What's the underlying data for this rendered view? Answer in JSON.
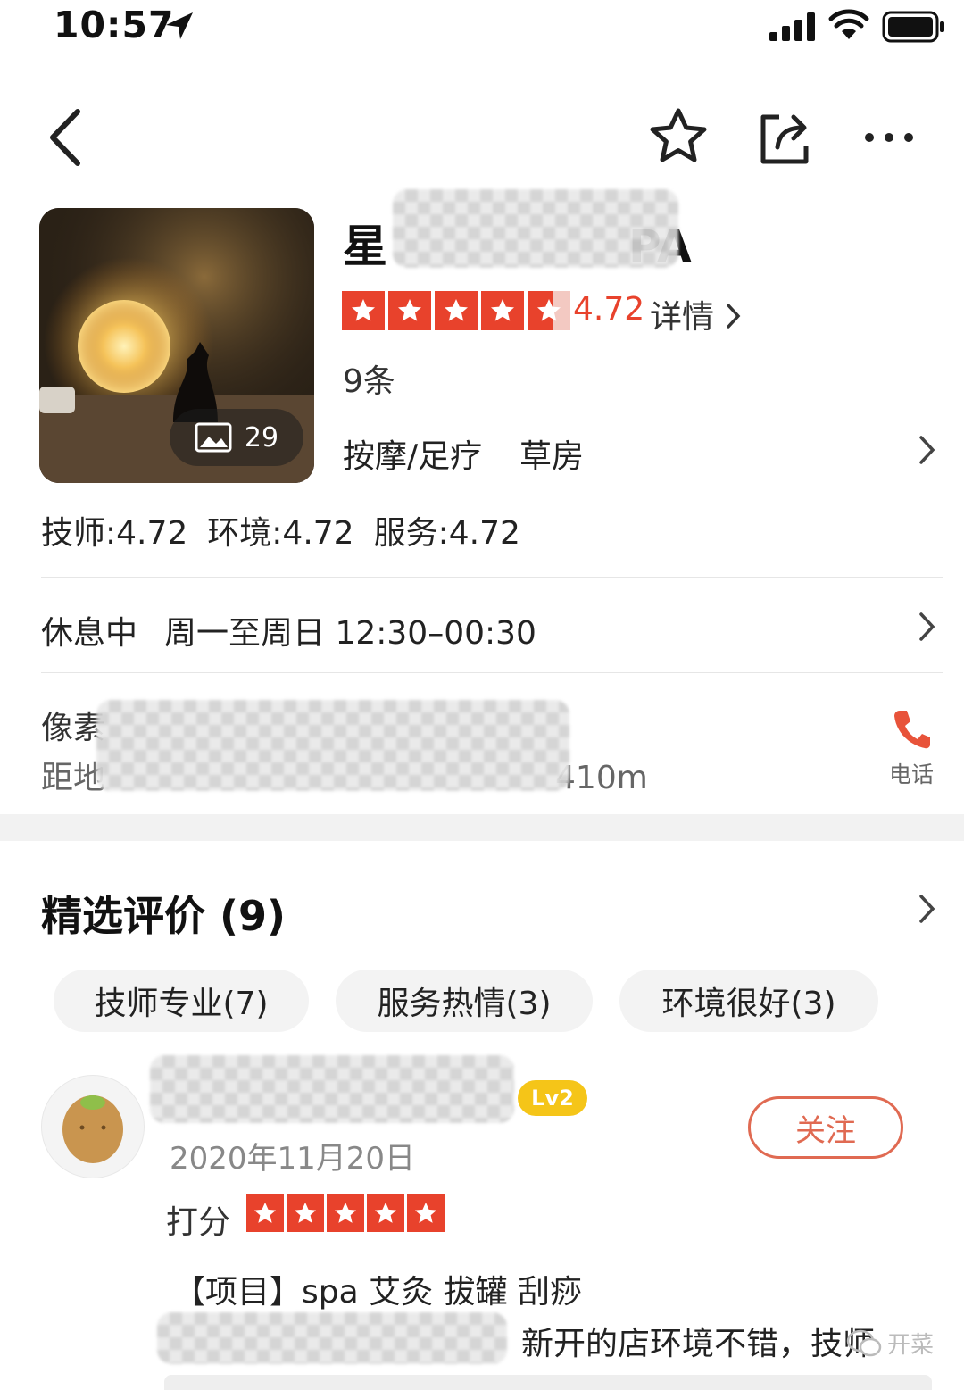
{
  "status_bar": {
    "time": "10:57"
  },
  "shop": {
    "title_start": "星",
    "title_end": "PA",
    "photo_count": "29",
    "score": "4.72",
    "detail_label": "详情",
    "review_count_label": "9条",
    "category": "按摩/足疗",
    "area": "草房",
    "sub_scores": [
      "技师:4.72",
      "环境:4.72",
      "服务:4.72"
    ],
    "star_rating": 4.72
  },
  "hours": {
    "status": "休息中",
    "range": "周一至周日 12:30–00:30"
  },
  "address": {
    "line1_visible": "像素",
    "metro_start": "距地",
    "metro_end": "410m"
  },
  "phone": {
    "label": "电话"
  },
  "reviews": {
    "title": "精选评价",
    "count": "(9)",
    "tags": [
      "技师专业(7)",
      "服务热情(3)",
      "环境很好(3)"
    ],
    "items": [
      {
        "level": "Lv2",
        "follow_label": "关注",
        "date": "2020年11月20日",
        "rating_label": "打分",
        "rating": 5,
        "project": "【项目】spa 艾灸 拔罐 刮痧",
        "text_visible": "新开的店环境不错，技师"
      }
    ]
  },
  "watermark": {
    "text": "开菜"
  },
  "colors": {
    "accent": "#e8422c",
    "follow": "#e06a52",
    "level_badge": "#f5c518"
  }
}
